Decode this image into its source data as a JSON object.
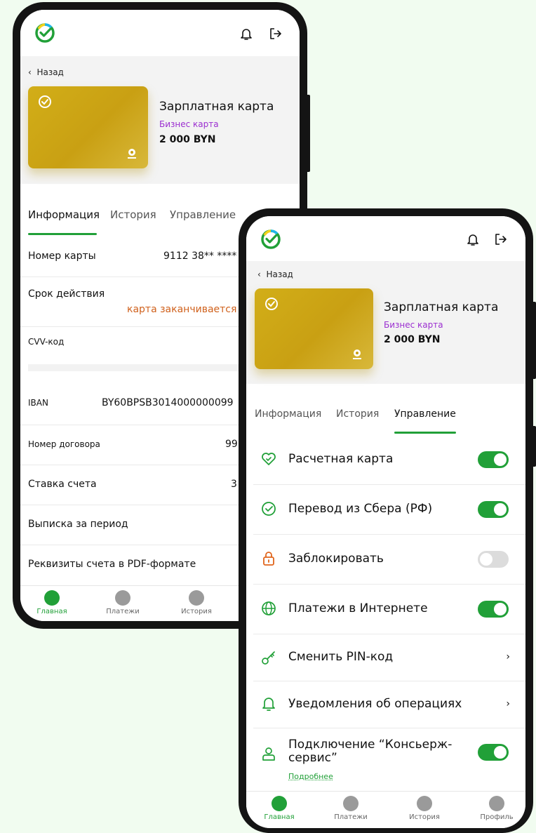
{
  "back_label": "Назад",
  "card": {
    "title": "Зарплатная карта",
    "type": "Бизнес карта",
    "balance": "2 000 BYN",
    "brand_mark": "БЕЛКАРТ"
  },
  "tabs": {
    "info": "Информация",
    "history": "История",
    "manage": "Управление"
  },
  "info": {
    "card_number_label": "Номер карты",
    "card_number_value": "9112 38** ****",
    "expiry_label": "Срок действия",
    "expiry_warning": "карта заканчивается ч",
    "cvv_label": "CVV-код",
    "iban_label": "IBAN",
    "iban_value": "BY60BPSB3014000000099",
    "contract_label": "Номер договора",
    "contract_value": "99",
    "rate_label": "Ставка счета",
    "rate_value": "3",
    "statement_label": "Выписка за период",
    "requisites_label": "Реквизиты счета в PDF-формате"
  },
  "manage": {
    "settlement": "Расчетная карта",
    "sber_transfer": "Перевод из Сбера (РФ)",
    "block": "Заблокировать",
    "internet_payments": "Платежи в Интернете",
    "change_pin": "Сменить PIN-код",
    "notifications": "Уведомления об операциях",
    "concierge_line1": "Подключение “Консьерж-",
    "concierge_line2": "сервис”",
    "more_link": "Подробнее",
    "toggles": {
      "settlement": true,
      "sber_transfer": true,
      "block": false,
      "internet_payments": true,
      "concierge": true
    }
  },
  "nav": {
    "home": "Главная",
    "payments": "Платежи",
    "history": "История",
    "profile": "Профиль"
  },
  "colors": {
    "accent": "#21a038",
    "warning": "#d0611c",
    "card_type": "#9b2fd0",
    "card_gold": "#c9a013"
  }
}
